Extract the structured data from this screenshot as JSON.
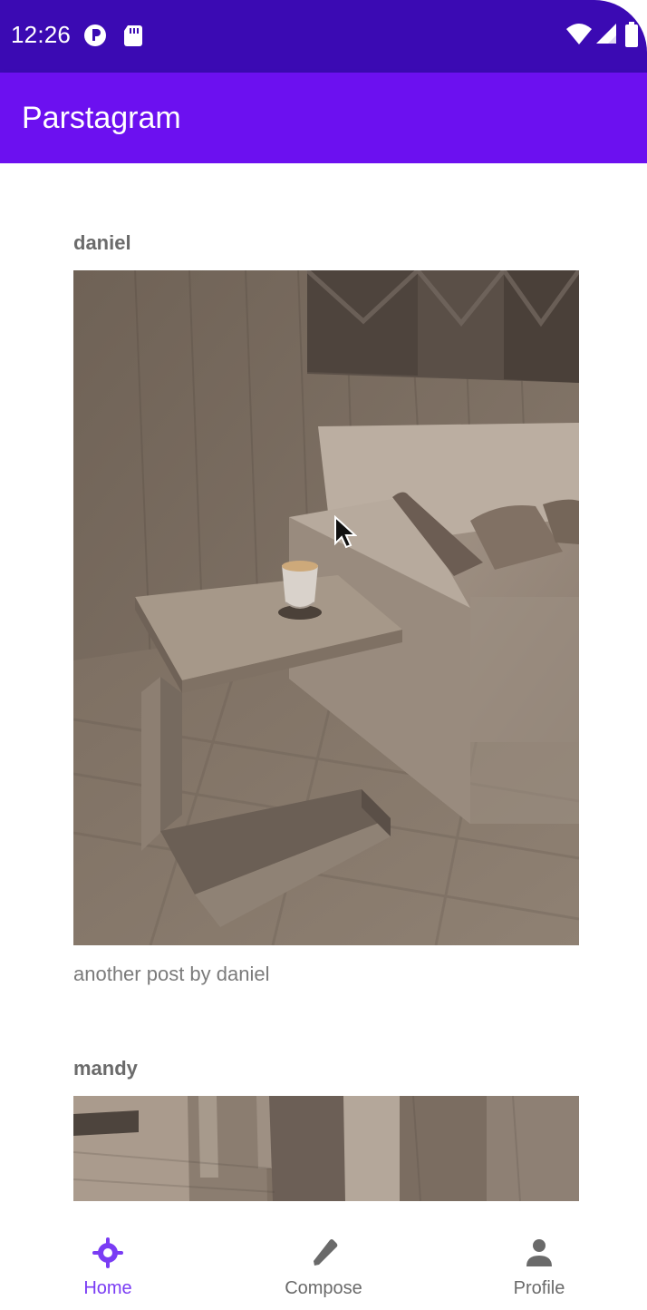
{
  "status": {
    "time": "12:26",
    "left_icons": [
      "parse-icon",
      "sd-card-icon"
    ],
    "right_icons": [
      "wifi-icon",
      "signal-icon",
      "battery-icon"
    ]
  },
  "app": {
    "title": "Parstagram",
    "primary_color": "#6c10f0",
    "status_color": "#3b0ab3"
  },
  "feed": {
    "posts": [
      {
        "username": "daniel",
        "caption": "another post by daniel",
        "image": "living-room-sofa-side-table"
      },
      {
        "username": "mandy",
        "caption": "",
        "image": "wooden-floor-interior"
      }
    ]
  },
  "bottom_nav": {
    "items": [
      {
        "label": "Home",
        "icon": "home-target-icon",
        "active": true
      },
      {
        "label": "Compose",
        "icon": "pencil-icon",
        "active": false
      },
      {
        "label": "Profile",
        "icon": "person-icon",
        "active": false
      }
    ],
    "active_color": "#7a3cf4",
    "inactive_color": "#6a6a6a"
  }
}
